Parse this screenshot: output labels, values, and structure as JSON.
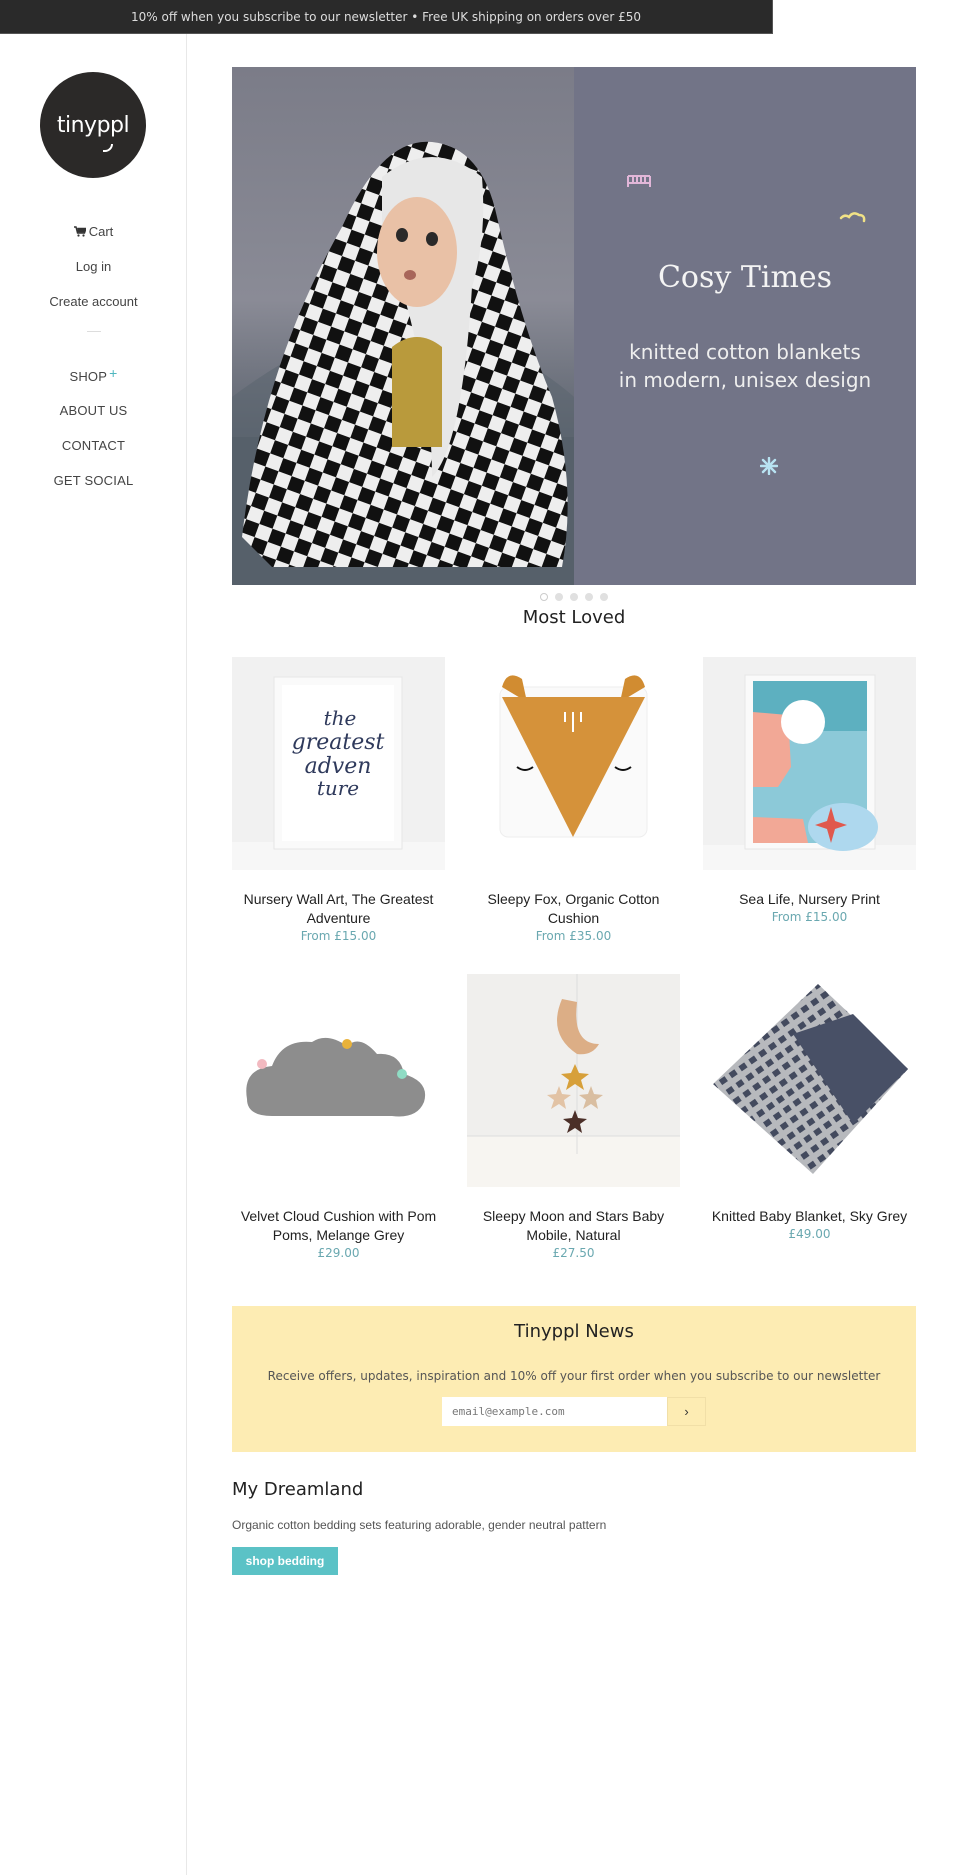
{
  "announcement": "10% off when you subscribe to our newsletter • Free UK shipping on orders over £50",
  "brand": {
    "logo_text": "tinyppl"
  },
  "sidebar": {
    "account_links": [
      {
        "label": "Cart",
        "icon": "cart-icon"
      },
      {
        "label": "Log in"
      },
      {
        "label": "Create account"
      }
    ],
    "nav": [
      {
        "label": "SHOP",
        "expand_icon": "+"
      },
      {
        "label": "ABOUT US"
      },
      {
        "label": "CONTACT"
      },
      {
        "label": "GET SOCIAL"
      }
    ]
  },
  "hero": {
    "title": "Cosy Times",
    "subtitle": "knitted cotton blankets\nin modern, unisex design",
    "photo_alt": "Baby wrapped in black and white knitted blanket",
    "slide_count": 5,
    "active_slide": 1,
    "colors": {
      "panel": "#727487"
    }
  },
  "most_loved": {
    "title": "Most Loved",
    "products": [
      {
        "name": "Nursery Wall Art, The Greatest Adventure",
        "price": "From £15.00",
        "image": "greatest-adventure-print"
      },
      {
        "name": "Sleepy Fox, Organic Cotton Cushion",
        "price": "From £35.00",
        "image": "fox-cushion"
      },
      {
        "name": "Sea Life, Nursery Print",
        "price": "From £15.00",
        "image": "sea-life-print"
      },
      {
        "name": "Velvet Cloud Cushion with Pom Poms, Melange Grey",
        "price": "£29.00",
        "image": "cloud-cushion"
      },
      {
        "name": "Sleepy Moon and Stars Baby Mobile, Natural",
        "price": "£27.50",
        "image": "moon-stars-mobile"
      },
      {
        "name": "Knitted Baby Blanket, Sky Grey",
        "price": "£49.00",
        "image": "knitted-blanket"
      }
    ]
  },
  "newsletter": {
    "title": "Tinyppl News",
    "text": "Receive offers, updates, inspiration and 10% off your first order when you subscribe to our newsletter",
    "input_value": "",
    "placeholder": "email@example.com",
    "submit_label": "›"
  },
  "dreamland": {
    "title": "My Dreamland",
    "text": "Organic cotton bedding sets featuring adorable, gender neutral pattern",
    "button_label": "shop bedding"
  },
  "colors": {
    "accent": "#5bc2c6",
    "price": "#6aa8b0",
    "newsletter_bg": "#fdecb3",
    "announcement_bg": "#2a2a2a"
  }
}
